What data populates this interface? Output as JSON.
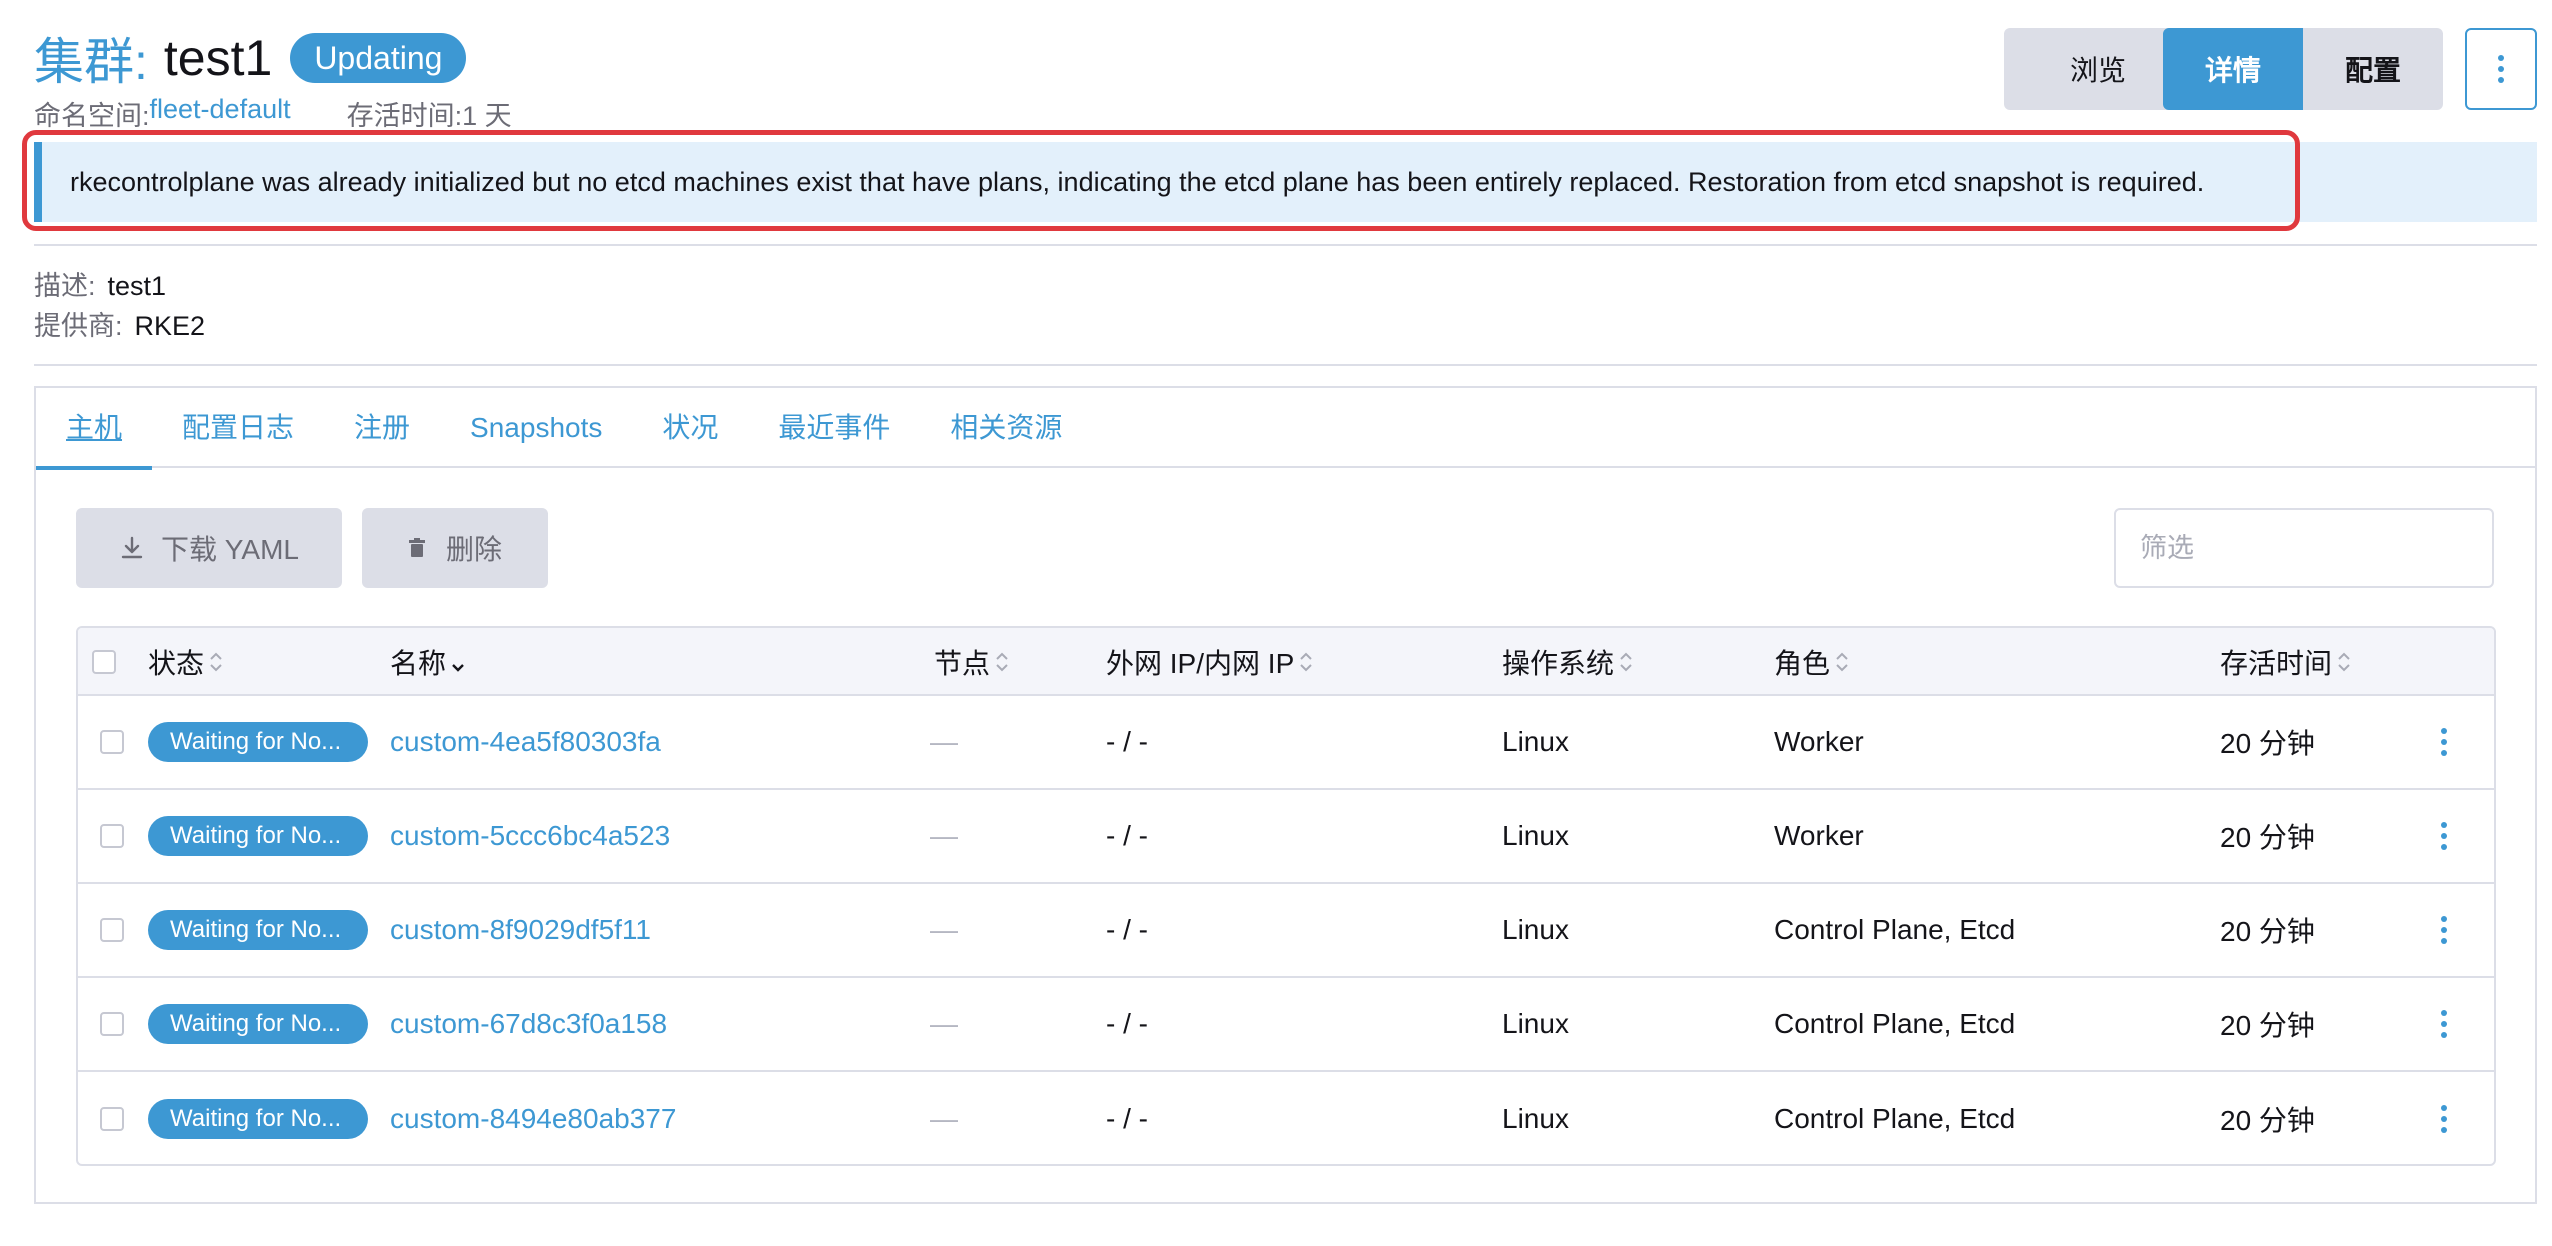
{
  "header": {
    "title_prefix": "集群:",
    "title_name": "test1",
    "state_badge": "Updating",
    "namespace_label": "命名空间: ",
    "namespace_value": "fleet-default",
    "age_label": "存活时间: ",
    "age_value": "1 天",
    "actions": {
      "browse": "浏览",
      "detail": "详情",
      "config": "配置"
    }
  },
  "banner": {
    "message": "rkecontrolplane was already initialized but no etcd machines exist that have plans, indicating the etcd plane has been entirely replaced. Restoration from etcd snapshot is required."
  },
  "details": {
    "description_label": "描述:",
    "description_value": "test1",
    "provider_label": "提供商:",
    "provider_value": "RKE2"
  },
  "tabs": [
    {
      "label": "主机",
      "active": true
    },
    {
      "label": "配置日志",
      "active": false
    },
    {
      "label": "注册",
      "active": false
    },
    {
      "label": "Snapshots",
      "active": false
    },
    {
      "label": "状况",
      "active": false
    },
    {
      "label": "最近事件",
      "active": false
    },
    {
      "label": "相关资源",
      "active": false
    }
  ],
  "toolbar": {
    "download_label": "下载 YAML",
    "delete_label": "删除",
    "filter_placeholder": "筛选"
  },
  "table": {
    "columns": {
      "state": "状态",
      "name": "名称",
      "node": "节点",
      "ip": "外网 IP/内网 IP",
      "os": "操作系统",
      "roles": "角色",
      "age": "存活时间"
    },
    "rows": [
      {
        "state": "Waiting for No...",
        "name": "custom-4ea5f80303fa",
        "node": "—",
        "ip": "- / -",
        "os": "Linux",
        "roles": "Worker",
        "age": "20 分钟"
      },
      {
        "state": "Waiting for No...",
        "name": "custom-5ccc6bc4a523",
        "node": "—",
        "ip": "- / -",
        "os": "Linux",
        "roles": "Worker",
        "age": "20 分钟"
      },
      {
        "state": "Waiting for No...",
        "name": "custom-8f9029df5f11",
        "node": "—",
        "ip": "- / -",
        "os": "Linux",
        "roles": "Control Plane, Etcd",
        "age": "20 分钟"
      },
      {
        "state": "Waiting for No...",
        "name": "custom-67d8c3f0a158",
        "node": "—",
        "ip": "- / -",
        "os": "Linux",
        "roles": "Control Plane, Etcd",
        "age": "20 分钟"
      },
      {
        "state": "Waiting for No...",
        "name": "custom-8494e80ab377",
        "node": "—",
        "ip": "- / -",
        "os": "Linux",
        "roles": "Control Plane, Etcd",
        "age": "20 分钟"
      }
    ]
  },
  "colors": {
    "accent": "#3d98d3",
    "highlight_border": "#e0393e",
    "banner_bg": "#e3f0fb",
    "button_gray": "#dcdee7"
  }
}
